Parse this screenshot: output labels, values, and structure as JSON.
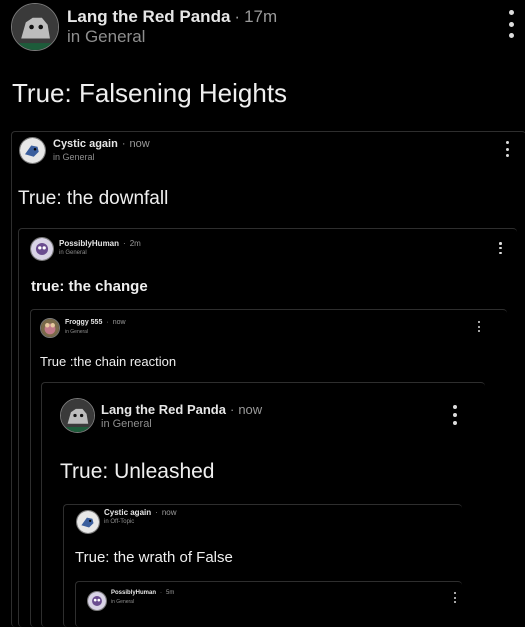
{
  "posts": [
    {
      "author": "Lang the Red Panda",
      "time": "17m",
      "channel": "in General",
      "title": "True: Falsening Heights",
      "avatar": "red-panda-avatar"
    },
    {
      "author": "Cystic again",
      "time": "now",
      "channel": "in General",
      "title": "True: the downfall",
      "avatar": "bird-avatar"
    },
    {
      "author": "PossiblyHuman",
      "time": "2m",
      "channel": "in General",
      "title": "true: the change",
      "avatar": "creature-avatar"
    },
    {
      "author": "Froggy 555",
      "time": "now",
      "channel": "in General",
      "title": "True :the chain reaction",
      "avatar": "frog-avatar"
    },
    {
      "author": "Lang the Red Panda",
      "time": "now",
      "channel": "in General",
      "title": "True: Unleashed",
      "avatar": "red-panda-avatar"
    },
    {
      "author": "Cystic again",
      "time": "now",
      "channel": "in Off-Topic",
      "title": "True: the wrath of False",
      "avatar": "bird-avatar"
    },
    {
      "author": "PossiblyHuman",
      "time": "5m",
      "channel": "in General",
      "title": "",
      "avatar": "creature-avatar"
    }
  ],
  "separator": "·"
}
